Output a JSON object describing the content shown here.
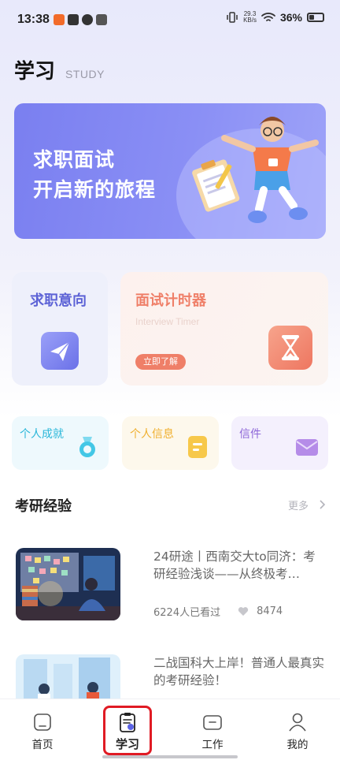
{
  "status_bar": {
    "time": "13:38",
    "net_speed_value": "29.3",
    "net_speed_unit": "KB/s",
    "battery": "36%"
  },
  "header": {
    "title": "学习",
    "subtitle": "STUDY"
  },
  "banner": {
    "line1": "求职面试",
    "line2": "开启新的旅程"
  },
  "features": {
    "job_intent": {
      "title": "求职意向",
      "icon": "paper-plane-icon"
    },
    "timer": {
      "title": "面试计时器",
      "subtitle": "Interview Timer",
      "button": "立即了解",
      "icon": "hourglass-icon"
    },
    "achievements": {
      "title": "个人成就",
      "icon": "medal-icon"
    },
    "personal_info": {
      "title": "个人信息",
      "icon": "document-icon"
    },
    "mail": {
      "title": "信件",
      "icon": "envelope-icon"
    }
  },
  "section": {
    "title": "考研经验",
    "more": "更多"
  },
  "articles": [
    {
      "title": "24研途丨西南交大to同济：考研经验浅谈——从终极考…",
      "views": "6224人已看过",
      "likes": "8474"
    },
    {
      "title": "二战国科大上岸！普通人最真实的考研经验！"
    }
  ],
  "tabs": [
    {
      "label": "首页",
      "icon": "home-icon"
    },
    {
      "label": "学习",
      "icon": "clipboard-icon",
      "active": true
    },
    {
      "label": "工作",
      "icon": "briefcase-icon"
    },
    {
      "label": "我的",
      "icon": "user-icon"
    }
  ],
  "colors": {
    "accent": "#7a7ff0",
    "timer": "#ef7f68",
    "highlight_box": "#e01b24"
  }
}
